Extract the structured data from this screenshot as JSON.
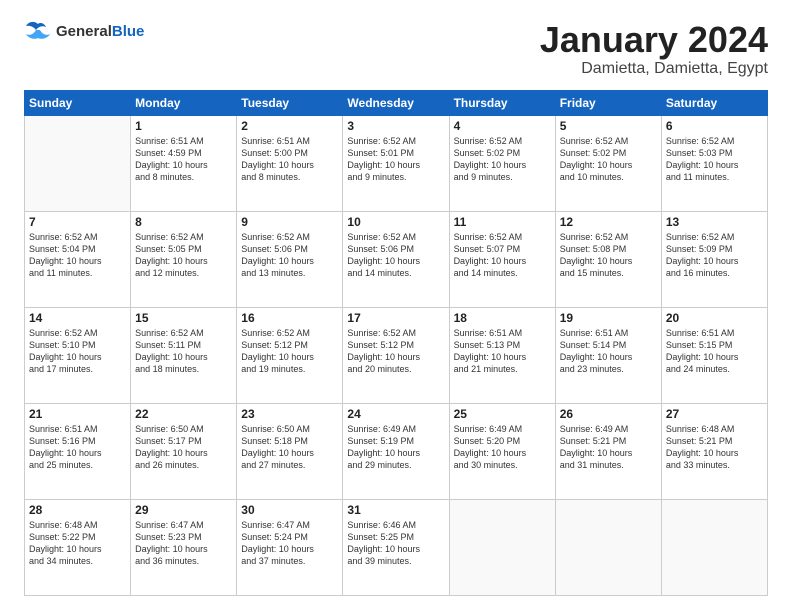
{
  "header": {
    "logo": {
      "general": "General",
      "blue": "Blue"
    },
    "title": "January 2024",
    "location": "Damietta, Damietta, Egypt"
  },
  "weekdays": [
    "Sunday",
    "Monday",
    "Tuesday",
    "Wednesday",
    "Thursday",
    "Friday",
    "Saturday"
  ],
  "weeks": [
    [
      {
        "day": "",
        "info": ""
      },
      {
        "day": "1",
        "info": "Sunrise: 6:51 AM\nSunset: 4:59 PM\nDaylight: 10 hours\nand 8 minutes."
      },
      {
        "day": "2",
        "info": "Sunrise: 6:51 AM\nSunset: 5:00 PM\nDaylight: 10 hours\nand 8 minutes."
      },
      {
        "day": "3",
        "info": "Sunrise: 6:52 AM\nSunset: 5:01 PM\nDaylight: 10 hours\nand 9 minutes."
      },
      {
        "day": "4",
        "info": "Sunrise: 6:52 AM\nSunset: 5:02 PM\nDaylight: 10 hours\nand 9 minutes."
      },
      {
        "day": "5",
        "info": "Sunrise: 6:52 AM\nSunset: 5:02 PM\nDaylight: 10 hours\nand 10 minutes."
      },
      {
        "day": "6",
        "info": "Sunrise: 6:52 AM\nSunset: 5:03 PM\nDaylight: 10 hours\nand 11 minutes."
      }
    ],
    [
      {
        "day": "7",
        "info": "Sunrise: 6:52 AM\nSunset: 5:04 PM\nDaylight: 10 hours\nand 11 minutes."
      },
      {
        "day": "8",
        "info": "Sunrise: 6:52 AM\nSunset: 5:05 PM\nDaylight: 10 hours\nand 12 minutes."
      },
      {
        "day": "9",
        "info": "Sunrise: 6:52 AM\nSunset: 5:06 PM\nDaylight: 10 hours\nand 13 minutes."
      },
      {
        "day": "10",
        "info": "Sunrise: 6:52 AM\nSunset: 5:06 PM\nDaylight: 10 hours\nand 14 minutes."
      },
      {
        "day": "11",
        "info": "Sunrise: 6:52 AM\nSunset: 5:07 PM\nDaylight: 10 hours\nand 14 minutes."
      },
      {
        "day": "12",
        "info": "Sunrise: 6:52 AM\nSunset: 5:08 PM\nDaylight: 10 hours\nand 15 minutes."
      },
      {
        "day": "13",
        "info": "Sunrise: 6:52 AM\nSunset: 5:09 PM\nDaylight: 10 hours\nand 16 minutes."
      }
    ],
    [
      {
        "day": "14",
        "info": "Sunrise: 6:52 AM\nSunset: 5:10 PM\nDaylight: 10 hours\nand 17 minutes."
      },
      {
        "day": "15",
        "info": "Sunrise: 6:52 AM\nSunset: 5:11 PM\nDaylight: 10 hours\nand 18 minutes."
      },
      {
        "day": "16",
        "info": "Sunrise: 6:52 AM\nSunset: 5:12 PM\nDaylight: 10 hours\nand 19 minutes."
      },
      {
        "day": "17",
        "info": "Sunrise: 6:52 AM\nSunset: 5:12 PM\nDaylight: 10 hours\nand 20 minutes."
      },
      {
        "day": "18",
        "info": "Sunrise: 6:51 AM\nSunset: 5:13 PM\nDaylight: 10 hours\nand 21 minutes."
      },
      {
        "day": "19",
        "info": "Sunrise: 6:51 AM\nSunset: 5:14 PM\nDaylight: 10 hours\nand 23 minutes."
      },
      {
        "day": "20",
        "info": "Sunrise: 6:51 AM\nSunset: 5:15 PM\nDaylight: 10 hours\nand 24 minutes."
      }
    ],
    [
      {
        "day": "21",
        "info": "Sunrise: 6:51 AM\nSunset: 5:16 PM\nDaylight: 10 hours\nand 25 minutes."
      },
      {
        "day": "22",
        "info": "Sunrise: 6:50 AM\nSunset: 5:17 PM\nDaylight: 10 hours\nand 26 minutes."
      },
      {
        "day": "23",
        "info": "Sunrise: 6:50 AM\nSunset: 5:18 PM\nDaylight: 10 hours\nand 27 minutes."
      },
      {
        "day": "24",
        "info": "Sunrise: 6:49 AM\nSunset: 5:19 PM\nDaylight: 10 hours\nand 29 minutes."
      },
      {
        "day": "25",
        "info": "Sunrise: 6:49 AM\nSunset: 5:20 PM\nDaylight: 10 hours\nand 30 minutes."
      },
      {
        "day": "26",
        "info": "Sunrise: 6:49 AM\nSunset: 5:21 PM\nDaylight: 10 hours\nand 31 minutes."
      },
      {
        "day": "27",
        "info": "Sunrise: 6:48 AM\nSunset: 5:21 PM\nDaylight: 10 hours\nand 33 minutes."
      }
    ],
    [
      {
        "day": "28",
        "info": "Sunrise: 6:48 AM\nSunset: 5:22 PM\nDaylight: 10 hours\nand 34 minutes."
      },
      {
        "day": "29",
        "info": "Sunrise: 6:47 AM\nSunset: 5:23 PM\nDaylight: 10 hours\nand 36 minutes."
      },
      {
        "day": "30",
        "info": "Sunrise: 6:47 AM\nSunset: 5:24 PM\nDaylight: 10 hours\nand 37 minutes."
      },
      {
        "day": "31",
        "info": "Sunrise: 6:46 AM\nSunset: 5:25 PM\nDaylight: 10 hours\nand 39 minutes."
      },
      {
        "day": "",
        "info": ""
      },
      {
        "day": "",
        "info": ""
      },
      {
        "day": "",
        "info": ""
      }
    ]
  ]
}
